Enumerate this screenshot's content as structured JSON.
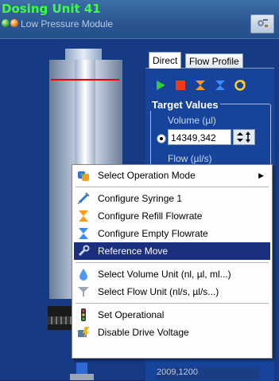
{
  "window": {
    "title": "Dosing Unit 41",
    "subtitle": "Low Pressure Module"
  },
  "tabs": [
    {
      "label": "Direct"
    },
    {
      "label": "Flow Profile"
    }
  ],
  "target_values": {
    "title": "Target Values",
    "volume_label": "Volume (µl)",
    "volume_value": "14349,342",
    "flow_label": "Flow (µl/s)",
    "bottom_field": "2009,1200"
  },
  "context_menu": {
    "items": [
      {
        "label": "Select Operation Mode",
        "icon": "mode-icon",
        "submenu": true
      },
      {
        "label": "Configure Syringe 1",
        "icon": "syringe-icon"
      },
      {
        "label": "Configure Refill Flowrate",
        "icon": "refill-icon"
      },
      {
        "label": "Configure Empty Flowrate",
        "icon": "empty-icon"
      },
      {
        "label": "Reference Move",
        "icon": "wrench-icon",
        "highlighted": true
      },
      {
        "label": "Select Volume Unit (nl, µl, ml...)",
        "icon": "volume-unit-icon"
      },
      {
        "label": "Select Flow Unit (nl/s, µl/s...)",
        "icon": "flow-unit-icon"
      },
      {
        "label": "Set Operational",
        "icon": "traffic-light-icon"
      },
      {
        "label": "Disable Drive Voltage",
        "icon": "disable-voltage-icon"
      }
    ]
  },
  "colors": {
    "title_green": "#3cff3c",
    "highlight": "#1c2f7c",
    "panel_blue": "#17449a"
  }
}
